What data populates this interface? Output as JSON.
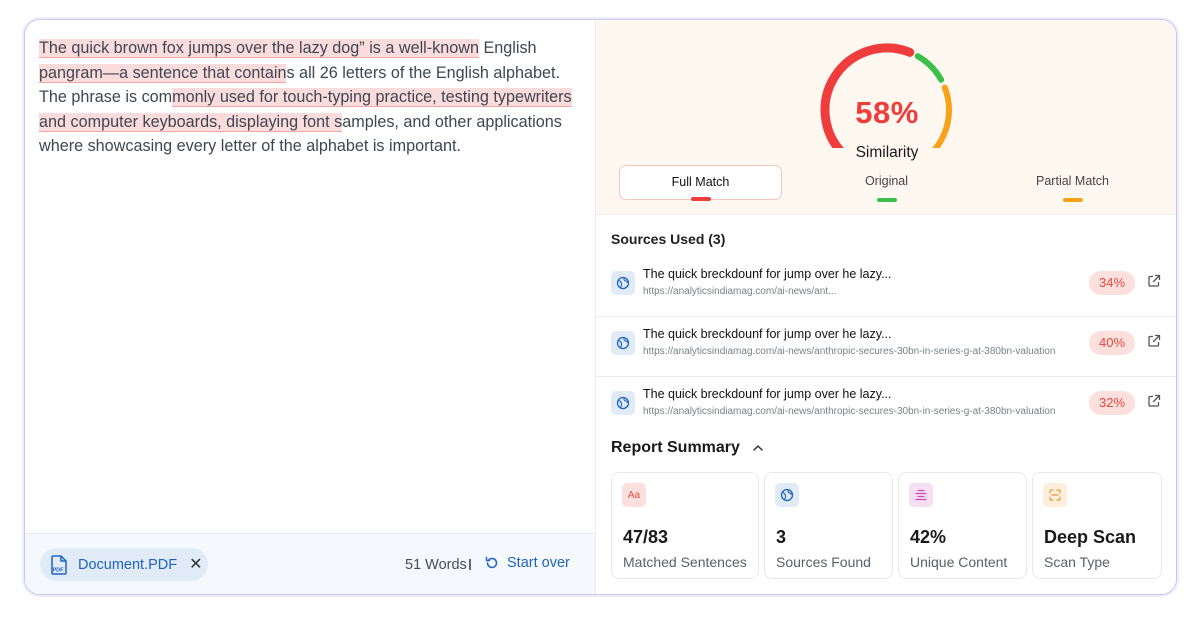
{
  "document": {
    "seg1": "The quick brown fox jumps over the lazy dog” is a well-known",
    "seg2": " English ",
    "seg3": "pangram—a sentence that contain",
    "seg4": "s all 26 letters of the English alphabet. The phrase is com",
    "seg5": "monly used for touch-typing practice, testing typewriters and computer keyboards, displaying font s",
    "seg6": "amples, and other applications where showcasing every letter of the alphabet is important."
  },
  "footer": {
    "file_name": "Document.PDF",
    "close_glyph": "✕",
    "word_count": "51 Words",
    "start_over": "Start over"
  },
  "score": {
    "percent_text": "58%",
    "percent_value": 58,
    "label": "Similarity",
    "colors": {
      "full": "#ef3d3d",
      "original": "#3cc04a",
      "partial": "#f6a31b"
    }
  },
  "tabs": [
    {
      "label": "Full Match",
      "active": true
    },
    {
      "label": "Original",
      "active": false
    },
    {
      "label": "Partial Match",
      "active": false
    }
  ],
  "sources": {
    "title": "Sources Used (3)",
    "items": [
      {
        "title": "The quick breckdounf for jump over he lazy...",
        "url": "https://analyticsindiamag.com/ai-news/ant...",
        "percent": "34%"
      },
      {
        "title": "The quick breckdounf for jump over he lazy...",
        "url": "https://analyticsindiamag.com/ai-news/anthropic-secures-30bn-in-series-g-at-380bn-valuation",
        "percent": "40%"
      },
      {
        "title": "The quick breckdounf for jump over he lazy...",
        "url": "https://analyticsindiamag.com/ai-news/anthropic-secures-30bn-in-series-g-at-380bn-valuation",
        "percent": "32%"
      }
    ]
  },
  "summary": {
    "title": "Report Summary",
    "cards": [
      {
        "icon": "text-aa-icon",
        "icon_text": "Aa",
        "value": "47/83",
        "label": "Matched Sentences"
      },
      {
        "icon": "globe-icon",
        "value": "3",
        "label": "Sources Found"
      },
      {
        "icon": "unique-content-icon",
        "value": "42%",
        "label": "Unique Content"
      },
      {
        "icon": "scan-icon",
        "value": "Deep Scan",
        "label": "Scan Type"
      }
    ]
  }
}
